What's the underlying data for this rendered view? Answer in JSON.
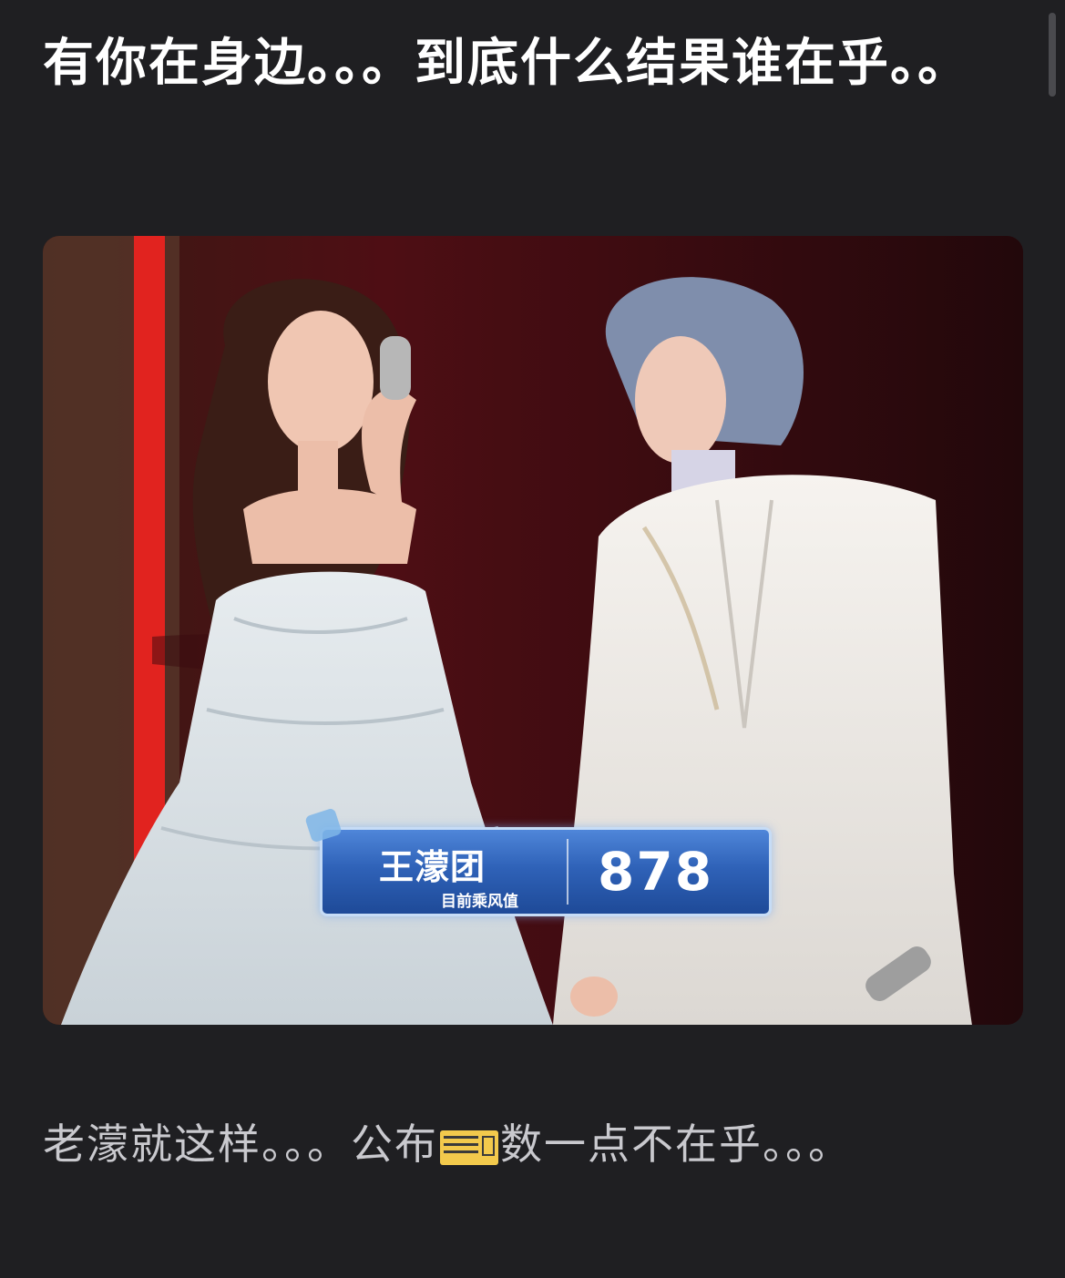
{
  "post": {
    "title": "有你在身边。。。到底什么结果谁在乎。。"
  },
  "photo": {
    "overlay": {
      "team": "王濛团",
      "subtitle": "目前乘风值",
      "score": "878"
    }
  },
  "caption": {
    "before_emoji": "老濛就这样。。。公布",
    "emoji": "ticket-emoji",
    "after_emoji": "数一点不在乎。。。"
  },
  "colors": {
    "background": "#1f1f22",
    "title_text": "#ffffff",
    "caption_text": "#c9c9ce",
    "overlay_blue": "#2f62b8"
  }
}
